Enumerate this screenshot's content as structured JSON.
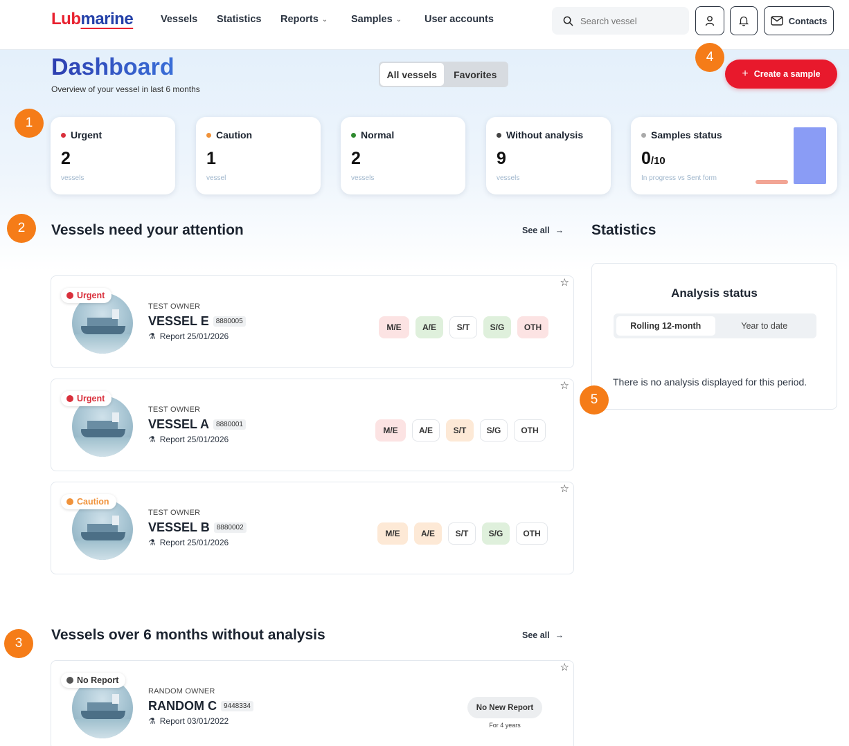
{
  "app": {
    "logo_part1": "Lub",
    "logo_part2": "marine"
  },
  "nav": {
    "items": [
      {
        "label": "Vessels",
        "dropdown": false
      },
      {
        "label": "Statistics",
        "dropdown": false
      },
      {
        "label": "Reports",
        "dropdown": true
      },
      {
        "label": "Samples",
        "dropdown": true
      },
      {
        "label": "User accounts",
        "dropdown": false
      }
    ],
    "search_placeholder": "Search vessel",
    "contacts_label": "Contacts"
  },
  "header": {
    "title": "Dashboard",
    "subtitle": "Overview of your vessel in last 6 months",
    "filter_tabs": [
      "All vessels",
      "Favorites"
    ],
    "active_filter": "All vessels",
    "create_label": "Create a sample"
  },
  "stats": [
    {
      "label": "Urgent",
      "value": "2",
      "unit": "vessels",
      "color": "#d9303c"
    },
    {
      "label": "Caution",
      "value": "1",
      "unit": "vessel",
      "color": "#f0923a"
    },
    {
      "label": "Normal",
      "value": "2",
      "unit": "vessels",
      "color": "#2f8a2f"
    },
    {
      "label": "Without analysis",
      "value": "9",
      "unit": "vessels",
      "color": "#444444"
    }
  ],
  "samples_status": {
    "label": "Samples status",
    "value": "0",
    "total": "/10",
    "unit": "In progress vs Sent form",
    "color": "#aaaaaa",
    "in_progress": 0,
    "sent": 10,
    "in_progress_color": "#f2a595",
    "sent_color": "#8a9cf5"
  },
  "attention": {
    "title": "Vessels need your attention",
    "see_all": "See all",
    "vessels": [
      {
        "status": "Urgent",
        "status_color": "#d9303c",
        "owner": "TEST OWNER",
        "name": "VESSEL E",
        "id": "8880005",
        "report": "Report 25/01/2026",
        "tags": [
          {
            "label": "M/E",
            "kind": "red"
          },
          {
            "label": "A/E",
            "kind": "green"
          },
          {
            "label": "S/T",
            "kind": "white"
          },
          {
            "label": "S/G",
            "kind": "green"
          },
          {
            "label": "OTH",
            "kind": "red"
          }
        ]
      },
      {
        "status": "Urgent",
        "status_color": "#d9303c",
        "owner": "TEST OWNER",
        "name": "VESSEL A",
        "id": "8880001",
        "report": "Report 25/01/2026",
        "tags": [
          {
            "label": "M/E",
            "kind": "red"
          },
          {
            "label": "A/E",
            "kind": "white"
          },
          {
            "label": "S/T",
            "kind": "orange"
          },
          {
            "label": "S/G",
            "kind": "white"
          },
          {
            "label": "OTH",
            "kind": "white"
          }
        ]
      },
      {
        "status": "Caution",
        "status_color": "#f0923a",
        "owner": "TEST OWNER",
        "name": "VESSEL B",
        "id": "8880002",
        "report": "Report 25/01/2026",
        "tags": [
          {
            "label": "M/E",
            "kind": "orange"
          },
          {
            "label": "A/E",
            "kind": "orange"
          },
          {
            "label": "S/T",
            "kind": "white"
          },
          {
            "label": "S/G",
            "kind": "green"
          },
          {
            "label": "OTH",
            "kind": "white"
          }
        ]
      }
    ]
  },
  "statistics": {
    "title": "Statistics",
    "panel_title": "Analysis status",
    "tabs": [
      "Rolling 12-month",
      "Year to date"
    ],
    "active_tab": "Rolling 12-month",
    "empty_message": "There is no analysis displayed for this period."
  },
  "no_analysis": {
    "title": "Vessels over 6 months without analysis",
    "see_all": "See all",
    "vessels": [
      {
        "status": "No Report",
        "status_color": "#555555",
        "owner": "RANDOM OWNER",
        "name": "RANDOM C",
        "id": "9448334",
        "report": "Report 03/01/2022",
        "badge": "No New Report",
        "badge_sub": "For 4 years"
      }
    ]
  },
  "annotations": [
    "1",
    "2",
    "3",
    "4",
    "5"
  ]
}
